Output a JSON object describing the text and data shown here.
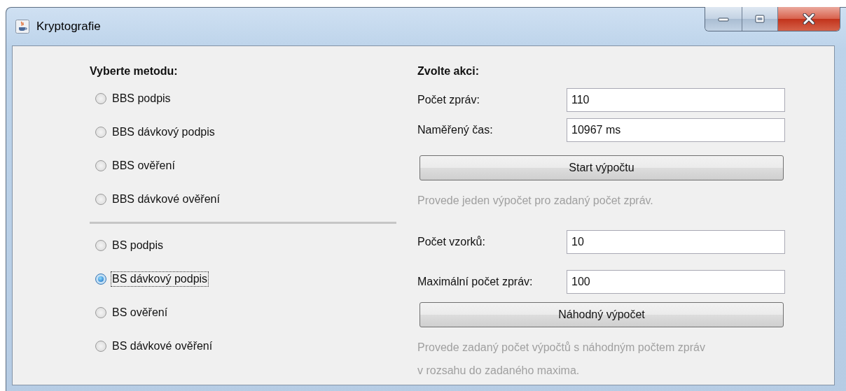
{
  "window": {
    "title": "Kryptografie"
  },
  "methods": {
    "heading": "Vyberte metodu:",
    "groups": [
      [
        {
          "label": "BBS podpis",
          "selected": false,
          "focused": false
        },
        {
          "label": "BBS dávkový podpis",
          "selected": false,
          "focused": false
        },
        {
          "label": "BBS ověření",
          "selected": false,
          "focused": false
        },
        {
          "label": "BBS dávkové ověření",
          "selected": false,
          "focused": false
        }
      ],
      [
        {
          "label": "BS podpis",
          "selected": false,
          "focused": false
        },
        {
          "label": "BS dávkový podpis",
          "selected": true,
          "focused": true
        },
        {
          "label": "BS ověření",
          "selected": false,
          "focused": false
        },
        {
          "label": "BS dávkové ověření",
          "selected": false,
          "focused": false
        }
      ]
    ]
  },
  "actions": {
    "heading": "Zvolte akci:",
    "sections": [
      {
        "fields": [
          {
            "label": "Počet zpráv:",
            "value": "110"
          },
          {
            "label": "Naměřený čas:",
            "value": "10967 ms"
          }
        ],
        "button": "Start výpočtu",
        "hint": "Provede jeden výpočet pro zadaný počet zpráv."
      },
      {
        "fields": [
          {
            "label": "Počet vzorků:",
            "value": "10"
          },
          {
            "label": "Maximální počet zpráv:",
            "value": "100"
          }
        ],
        "button": "Náhodný výpočet",
        "hint": "Provede zadaný počet výpočtů s náhodným počtem zpráv v rozsahu do zadaného maxima."
      }
    ]
  }
}
